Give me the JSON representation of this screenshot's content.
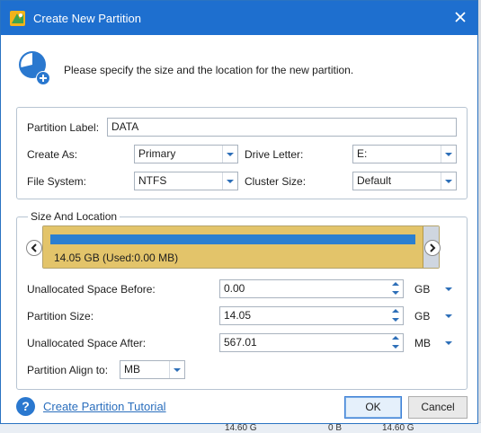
{
  "window": {
    "title": "Create New Partition"
  },
  "instruction": "Please specify the size and the location for the new partition.",
  "partition_settings": {
    "label_caption": "Partition Label:",
    "label_value": "DATA",
    "create_as_caption": "Create As:",
    "create_as_value": "Primary",
    "drive_letter_caption": "Drive Letter:",
    "drive_letter_value": "E:",
    "file_system_caption": "File System:",
    "file_system_value": "NTFS",
    "cluster_size_caption": "Cluster Size:",
    "cluster_size_value": "Default"
  },
  "size_and_location": {
    "group_title": "Size And Location",
    "partition_bar_text": "14.05 GB (Used:0.00 MB)",
    "partition_fill_fraction": 0.96,
    "unallocated_before_caption": "Unallocated Space Before:",
    "unallocated_before_value": "0.00",
    "unallocated_before_unit": "GB",
    "partition_size_caption": "Partition Size:",
    "partition_size_value": "14.05",
    "partition_size_unit": "GB",
    "unallocated_after_caption": "Unallocated Space After:",
    "unallocated_after_value": "567.01",
    "unallocated_after_unit": "MB",
    "align_caption": "Partition Align to:",
    "align_value": "MB"
  },
  "footer": {
    "tutorial_link": "Create Partition Tutorial",
    "ok_label": "OK",
    "cancel_label": "Cancel"
  },
  "background": {
    "cell_1": "14.60 G",
    "cell_2": "0 B",
    "cell_3": "14.60 G"
  },
  "colors": {
    "titlebar": "#1e6fcf",
    "partition_fill": "#e3c46a",
    "used_bar": "#2b7fd0",
    "accent": "#2d6fb8"
  }
}
